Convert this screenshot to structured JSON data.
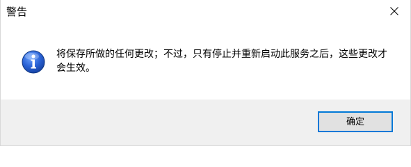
{
  "window": {
    "title": "警告",
    "close_icon": "close-icon"
  },
  "message": {
    "icon": "info-icon",
    "text": "将保存所做的任何更改；不过，只有停止并重新启动此服务之后，这些更改才会生效。"
  },
  "footer": {
    "ok_label": "确定"
  },
  "colors": {
    "accent": "#0078d7",
    "footer_bg": "#f0f0f0",
    "button_bg": "#e1e1e1",
    "icon_blue": "#1c58c8"
  }
}
